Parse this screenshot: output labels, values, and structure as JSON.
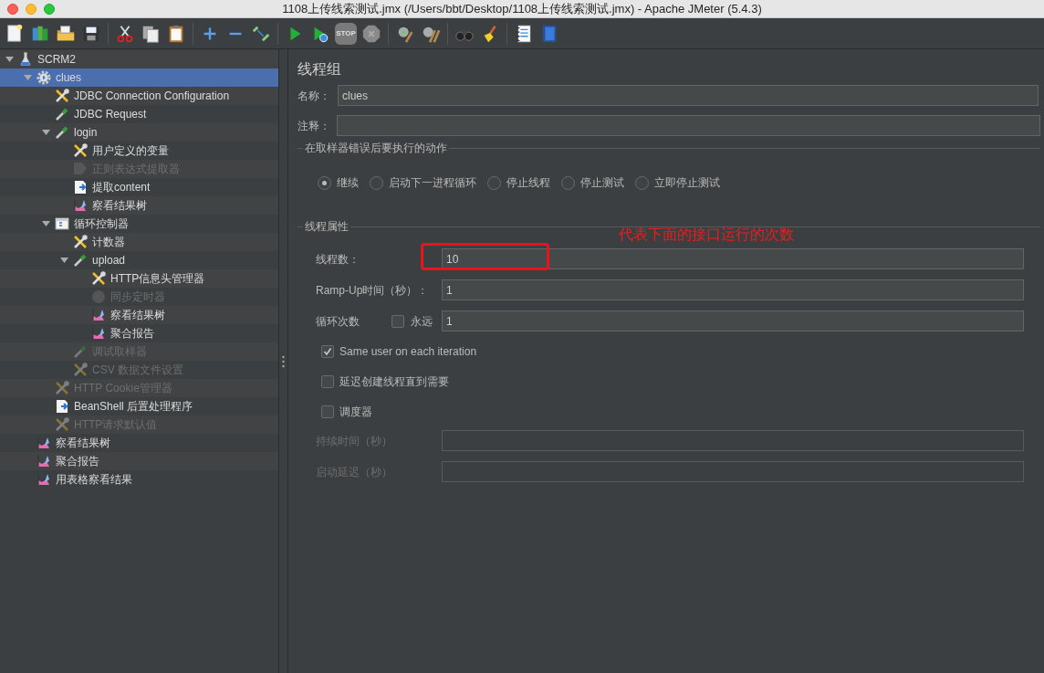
{
  "window": {
    "title": "1108上传线索测试.jmx (/Users/bbt/Desktop/1108上传线索测试.jmx) - Apache JMeter (5.4.3)"
  },
  "toolbar": [
    {
      "kind": "new"
    },
    {
      "kind": "templates"
    },
    {
      "kind": "open"
    },
    {
      "kind": "save"
    },
    {
      "kind": "sep"
    },
    {
      "kind": "cut"
    },
    {
      "kind": "copy"
    },
    {
      "kind": "paste"
    },
    {
      "kind": "sep"
    },
    {
      "kind": "expand"
    },
    {
      "kind": "collapse"
    },
    {
      "kind": "toggle"
    },
    {
      "kind": "sep"
    },
    {
      "kind": "start"
    },
    {
      "kind": "start-no-pause"
    },
    {
      "kind": "stop",
      "label": "STOP"
    },
    {
      "kind": "shutdown"
    },
    {
      "kind": "sep"
    },
    {
      "kind": "clear"
    },
    {
      "kind": "clear-all"
    },
    {
      "kind": "sep"
    },
    {
      "kind": "search"
    },
    {
      "kind": "reset-search"
    },
    {
      "kind": "sep"
    },
    {
      "kind": "function-helper"
    },
    {
      "kind": "help"
    }
  ],
  "tree": [
    {
      "label": "SCRM2",
      "kind": "testplan",
      "selected": false,
      "disabled": false,
      "expanded": true,
      "children": [
        {
          "label": "clues",
          "kind": "threadgroup",
          "selected": true,
          "disabled": false,
          "expanded": true,
          "children": [
            {
              "label": "JDBC Connection Configuration",
              "kind": "config",
              "selected": false,
              "disabled": false
            },
            {
              "label": "JDBC Request",
              "kind": "sampler",
              "selected": false,
              "disabled": false
            },
            {
              "label": "login",
              "kind": "sampler",
              "selected": false,
              "disabled": false,
              "expanded": true,
              "children": [
                {
                  "label": "用户定义的变量",
                  "kind": "config",
                  "selected": false,
                  "disabled": false
                },
                {
                  "label": "正则表达式提取器",
                  "kind": "extractor",
                  "selected": false,
                  "disabled": true
                },
                {
                  "label": "提取content",
                  "kind": "postprocessor",
                  "selected": false,
                  "disabled": false
                },
                {
                  "label": "察看结果树",
                  "kind": "listener",
                  "selected": false,
                  "disabled": false
                }
              ]
            },
            {
              "label": "循环控制器",
              "kind": "controller",
              "selected": false,
              "disabled": false,
              "expanded": true,
              "children": [
                {
                  "label": "计数器",
                  "kind": "config",
                  "selected": false,
                  "disabled": false
                },
                {
                  "label": "upload",
                  "kind": "sampler",
                  "selected": false,
                  "disabled": false,
                  "expanded": true,
                  "children": [
                    {
                      "label": "HTTP信息头管理器",
                      "kind": "config",
                      "selected": false,
                      "disabled": false
                    },
                    {
                      "label": "同步定时器",
                      "kind": "timer",
                      "selected": false,
                      "disabled": true
                    },
                    {
                      "label": "察看结果树",
                      "kind": "listener",
                      "selected": false,
                      "disabled": false
                    },
                    {
                      "label": "聚合报告",
                      "kind": "listener",
                      "selected": false,
                      "disabled": false
                    }
                  ]
                },
                {
                  "label": "调试取样器",
                  "kind": "sampler",
                  "selected": false,
                  "disabled": true
                },
                {
                  "label": "CSV 数据文件设置",
                  "kind": "config",
                  "selected": false,
                  "disabled": true
                }
              ]
            },
            {
              "label": "HTTP Cookie管理器",
              "kind": "config",
              "selected": false,
              "disabled": true
            },
            {
              "label": "BeanShell 后置处理程序",
              "kind": "postprocessor",
              "selected": false,
              "disabled": false
            },
            {
              "label": "HTTP请求默认值",
              "kind": "config",
              "selected": false,
              "disabled": true
            }
          ]
        },
        {
          "label": "察看结果树",
          "kind": "listener",
          "selected": false,
          "disabled": false
        },
        {
          "label": "聚合报告",
          "kind": "listener",
          "selected": false,
          "disabled": false
        },
        {
          "label": "用表格察看结果",
          "kind": "listener",
          "selected": false,
          "disabled": false
        }
      ]
    }
  ],
  "panel": {
    "title": "线程组",
    "name": {
      "label": "名称：",
      "value": "clues"
    },
    "comment": {
      "label": "注释："
    },
    "on_error": {
      "legend": "在取样器错误后要执行的动作",
      "options": [
        {
          "label": "继续",
          "selected": true
        },
        {
          "label": "启动下一进程循环",
          "selected": false
        },
        {
          "label": "停止线程",
          "selected": false
        },
        {
          "label": "停止测试",
          "selected": false
        },
        {
          "label": "立即停止测试",
          "selected": false
        }
      ]
    },
    "thread_properties": {
      "legend": "线程属性",
      "fields": [
        {
          "label": "线程数：",
          "value": "10",
          "highlighted": true
        },
        {
          "label": "Ramp-Up时间（秒）：",
          "value": "1"
        },
        {
          "label": "循环次数",
          "value": "1",
          "forever": {
            "label": "永远",
            "checked": false
          }
        }
      ],
      "options": [
        {
          "label": "Same user on each iteration",
          "checked": true
        },
        {
          "label": "延迟创建线程直到需要",
          "checked": false
        },
        {
          "label": "调度器",
          "checked": false
        }
      ],
      "scheduler_fields": [
        {
          "label": "持续时间（秒）",
          "disabled": true
        },
        {
          "label": "启动延迟（秒）",
          "disabled": true
        }
      ]
    },
    "annotation": {
      "text": "代表下面的接口运行的次数"
    }
  }
}
